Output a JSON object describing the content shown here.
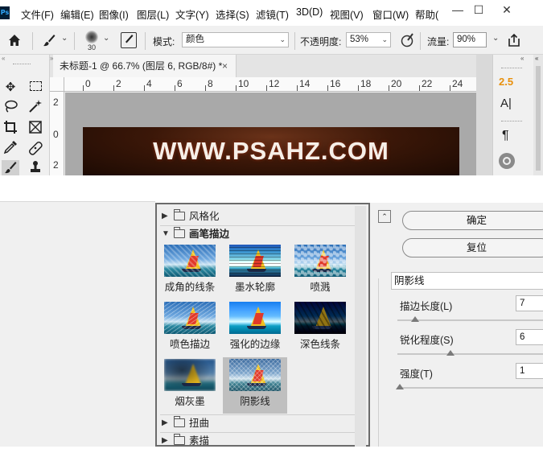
{
  "app": {
    "logo_text": "Ps",
    "menus": [
      "文件(F)",
      "编辑(E)",
      "图像(I)",
      "图层(L)",
      "文字(Y)",
      "选择(S)",
      "滤镜(T)",
      "3D(D)",
      "视图(V)",
      "窗口(W)",
      "帮助("
    ],
    "window_controls": [
      "—",
      "☐",
      "✕"
    ]
  },
  "options_bar": {
    "brush_size": "30",
    "mode_label": "模式:",
    "mode_value": "颜色",
    "opacity_label": "不透明度:",
    "opacity_value": "53%",
    "flow_label": "流量:",
    "flow_value": "90%"
  },
  "document": {
    "tab_title": "未标题-1 @ 66.7% (图层 6, RGB/8#) *",
    "tab_close": "×",
    "ruler_top": [
      "0",
      "2",
      "4",
      "6",
      "8",
      "10",
      "12",
      "14",
      "16",
      "18",
      "20",
      "22",
      "24"
    ],
    "ruler_left": [
      "2",
      "0",
      "2"
    ],
    "canvas_text": "WWW.PSAHZ.COM"
  },
  "right_panel": {
    "value": "2.5",
    "char_icon_text": "A|",
    "para_icon_text": "¶"
  },
  "filter_gallery": {
    "categories": [
      {
        "label": "风格化",
        "expanded": false
      },
      {
        "label": "画笔描边",
        "expanded": true
      },
      {
        "label": "扭曲",
        "expanded": false
      },
      {
        "label": "素描",
        "expanded": false
      }
    ],
    "filters": [
      {
        "label": "成角的线条",
        "selected": false
      },
      {
        "label": "墨水轮廓",
        "selected": false
      },
      {
        "label": "喷溅",
        "selected": false
      },
      {
        "label": "喷色描边",
        "selected": false
      },
      {
        "label": "强化的边缘",
        "selected": false
      },
      {
        "label": "深色线条",
        "selected": false
      },
      {
        "label": "烟灰墨",
        "selected": false
      },
      {
        "label": "阴影线",
        "selected": true
      }
    ]
  },
  "settings": {
    "ok_label": "确定",
    "reset_label": "复位",
    "selected_filter": "阴影线",
    "params": [
      {
        "label": "描边长度(L)",
        "value": "7",
        "slider_fraction": 0.1
      },
      {
        "label": "锐化程度(S)",
        "value": "6",
        "slider_fraction": 0.33
      },
      {
        "label": "强度(T)",
        "value": "1",
        "slider_fraction": 0.0
      }
    ]
  }
}
